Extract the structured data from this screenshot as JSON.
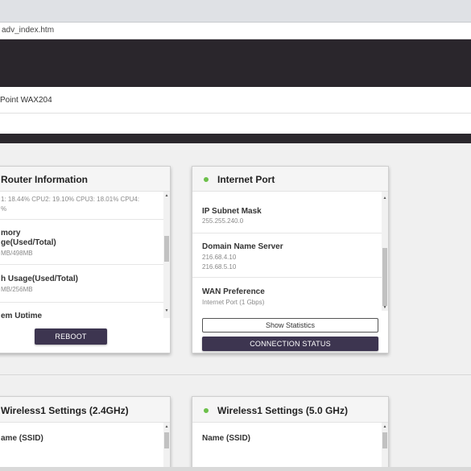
{
  "browser": {
    "url": "adv_index.htm"
  },
  "header": {
    "model_name": "Point WAX204"
  },
  "router_info": {
    "title": "Router Information",
    "cpu_value": "1: 18.44% CPU2: 19.10% CPU3: 18.01% CPU4: %",
    "memory_title_line1": "mory",
    "memory_title_line2": "ge(Used/Total)",
    "memory_value": "MB/498MB",
    "flash_title": "h Usage(Used/Total)",
    "flash_value": "MB/256MB",
    "uptime_title": "em Uptime",
    "reboot_label": "REBOOT"
  },
  "internet_port": {
    "title": "Internet Port",
    "status_color": "#6cc04a",
    "subnet_title": "IP Subnet Mask",
    "subnet_value": "255.255.240.0",
    "dns_title": "Domain Name Server",
    "dns_value_1": "216.68.4.10",
    "dns_value_2": "216.68.5.10",
    "wan_title": "WAN Preference",
    "wan_value": "Internet Port (1 Gbps)",
    "show_stats_label": "Show Statistics",
    "connection_status_label": "CONNECTION STATUS"
  },
  "wireless_24": {
    "title": "Wireless1 Settings (2.4GHz)",
    "ssid_title": "ame (SSID)"
  },
  "wireless_5": {
    "title": "Wireless1 Settings (5.0 GHz)",
    "status_color": "#6cc04a",
    "ssid_title": "Name (SSID)"
  },
  "colors": {
    "dark_header": "#2a262c",
    "button_purple": "#3d3550",
    "status_green": "#6cc04a"
  }
}
